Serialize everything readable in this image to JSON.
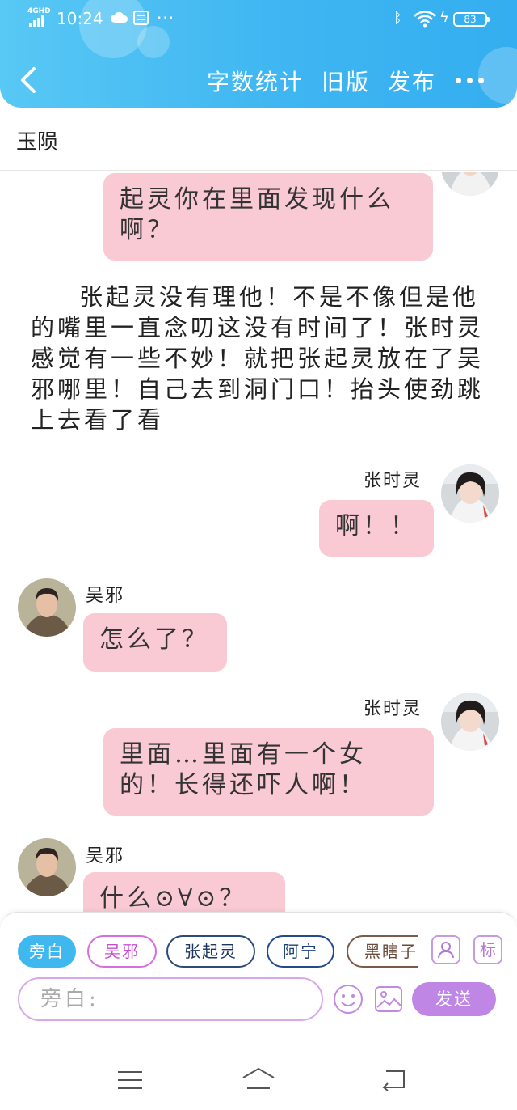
{
  "status_bar": {
    "network": "4GHD",
    "time": "10:24",
    "battery": "83"
  },
  "header": {
    "word_count": "字数统计",
    "old_version": "旧版",
    "publish": "发布"
  },
  "story_title": "玉陨",
  "messages": {
    "m1": {
      "text": "起灵你在里面发现什么啊？"
    },
    "narration": "张起灵没有理他！不是不像但是他的嘴里一直念叨这没有时间了！张时灵感觉有一些不妙！就把张起灵放在了吴邪哪里！自己去到洞门口！抬头使劲跳上去看了看",
    "m2": {
      "speaker": "张时灵",
      "text": "啊！！"
    },
    "m3": {
      "speaker": "吴邪",
      "text": "怎么了？"
    },
    "m4": {
      "speaker": "张时灵",
      "text": "里面…里面有一个女的！长得还吓人啊！"
    },
    "m5": {
      "speaker": "吴邪",
      "text": "什么⊙∀⊙？"
    }
  },
  "composer": {
    "chips": [
      "旁白",
      "吴邪",
      "张起灵",
      "阿宁",
      "黑瞎子"
    ],
    "tag_label": "标",
    "input_placeholder": "旁白:",
    "send": "发送"
  },
  "colors": {
    "header_blue": "#3fb6f2",
    "bubble_pink": "#f9c9d4",
    "send_purple": "#c086e6"
  },
  "icons": [
    "back-icon",
    "more-icon",
    "role-manage-icon",
    "tag-icon",
    "emoji-icon",
    "image-icon",
    "nav-menu-icon",
    "nav-home-icon",
    "nav-back-icon"
  ]
}
